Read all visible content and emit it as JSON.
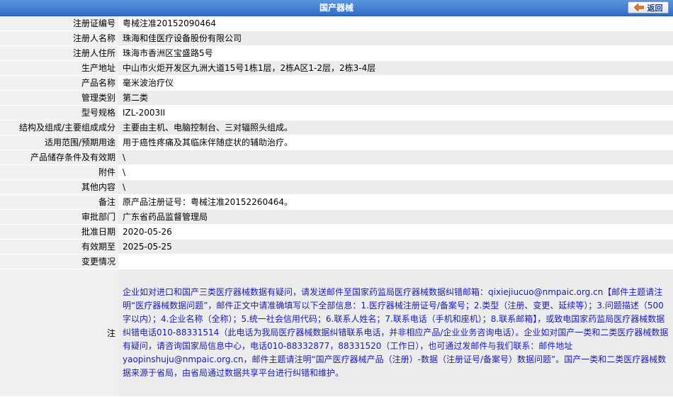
{
  "header": {
    "title": "国产器械",
    "back_label": "返回"
  },
  "fields": [
    {
      "label": "注册证编号",
      "value": "粤械注准20152090464"
    },
    {
      "label": "注册人名称",
      "value": "珠海和佳医疗设备股份有限公司"
    },
    {
      "label": "注册人住所",
      "value": "珠海市香洲区宝盛路5号"
    },
    {
      "label": "生产地址",
      "value": "中山市火炬开发区九洲大道15号1栋1层，2栋A区1-2层，2栋3-4层"
    },
    {
      "label": "产品名称",
      "value": "毫米波治疗仪"
    },
    {
      "label": "管理类别",
      "value": "第二类"
    },
    {
      "label": "型号规格",
      "value": "IZL-2003II"
    },
    {
      "label": "结构及组成/主要组成成分",
      "value": "主要由主机、电脑控制台、三对辐照头组成。"
    },
    {
      "label": "适用范围/预期用途",
      "value": "用于癌性疼痛及其临床伴随症状的辅助治疗。"
    },
    {
      "label": "产品储存条件及有效期",
      "value": "\\"
    },
    {
      "label": "附件",
      "value": "\\"
    },
    {
      "label": "其他内容",
      "value": "\\"
    },
    {
      "label": "备注",
      "value": "原产品注册证号：粤械注准20152260464。"
    },
    {
      "label": "审批部门",
      "value": "广东省药品监督管理局"
    },
    {
      "label": "批准日期",
      "value": "2020-05-26"
    },
    {
      "label": "有效期至",
      "value": "2025-05-25"
    },
    {
      "label": "变更情况",
      "value": ""
    }
  ],
  "note": {
    "label": "注",
    "text": "企业如对进口和国产三类医疗器械数据有疑问，请发送邮件至国家药监局医疗器械数据纠错邮箱：qixiejiucuo@nmpaic.org.cn【邮件主题请注明“医疗器械数据问题”，邮件正文中请准确填写以下全部信息：1.医疗器械注册证号/备案号；2.类型（注册、变更、延续等）；3.问题描述（500字以内）；4.企业名称（全称）；5.统一社会信用代码；6.联系人姓名；7.联系电话（手机和座机）；8.联系邮箱】，或致电国家药监局医疗器械数据纠错电话010-88331514（此电话为我局医疗器械数据纠错联系电话，并非相应产品/企业业务咨询电话）。企业如对国产一类和二类医疗器械数据有疑问，请咨询国家局信息中心，电话010-88332877，88331520（工作日），也可通过发邮件与我们联系：邮件地址yaopinshuju@nmpaic.org.cn，邮件主题请注明“国产医疗器械产品（注册）-数据（注册证号/备案号）数据问题”。国产一类和二类医疗器械数据来源于省局，由省局通过数据共享平台进行纠错和维护。"
  }
}
